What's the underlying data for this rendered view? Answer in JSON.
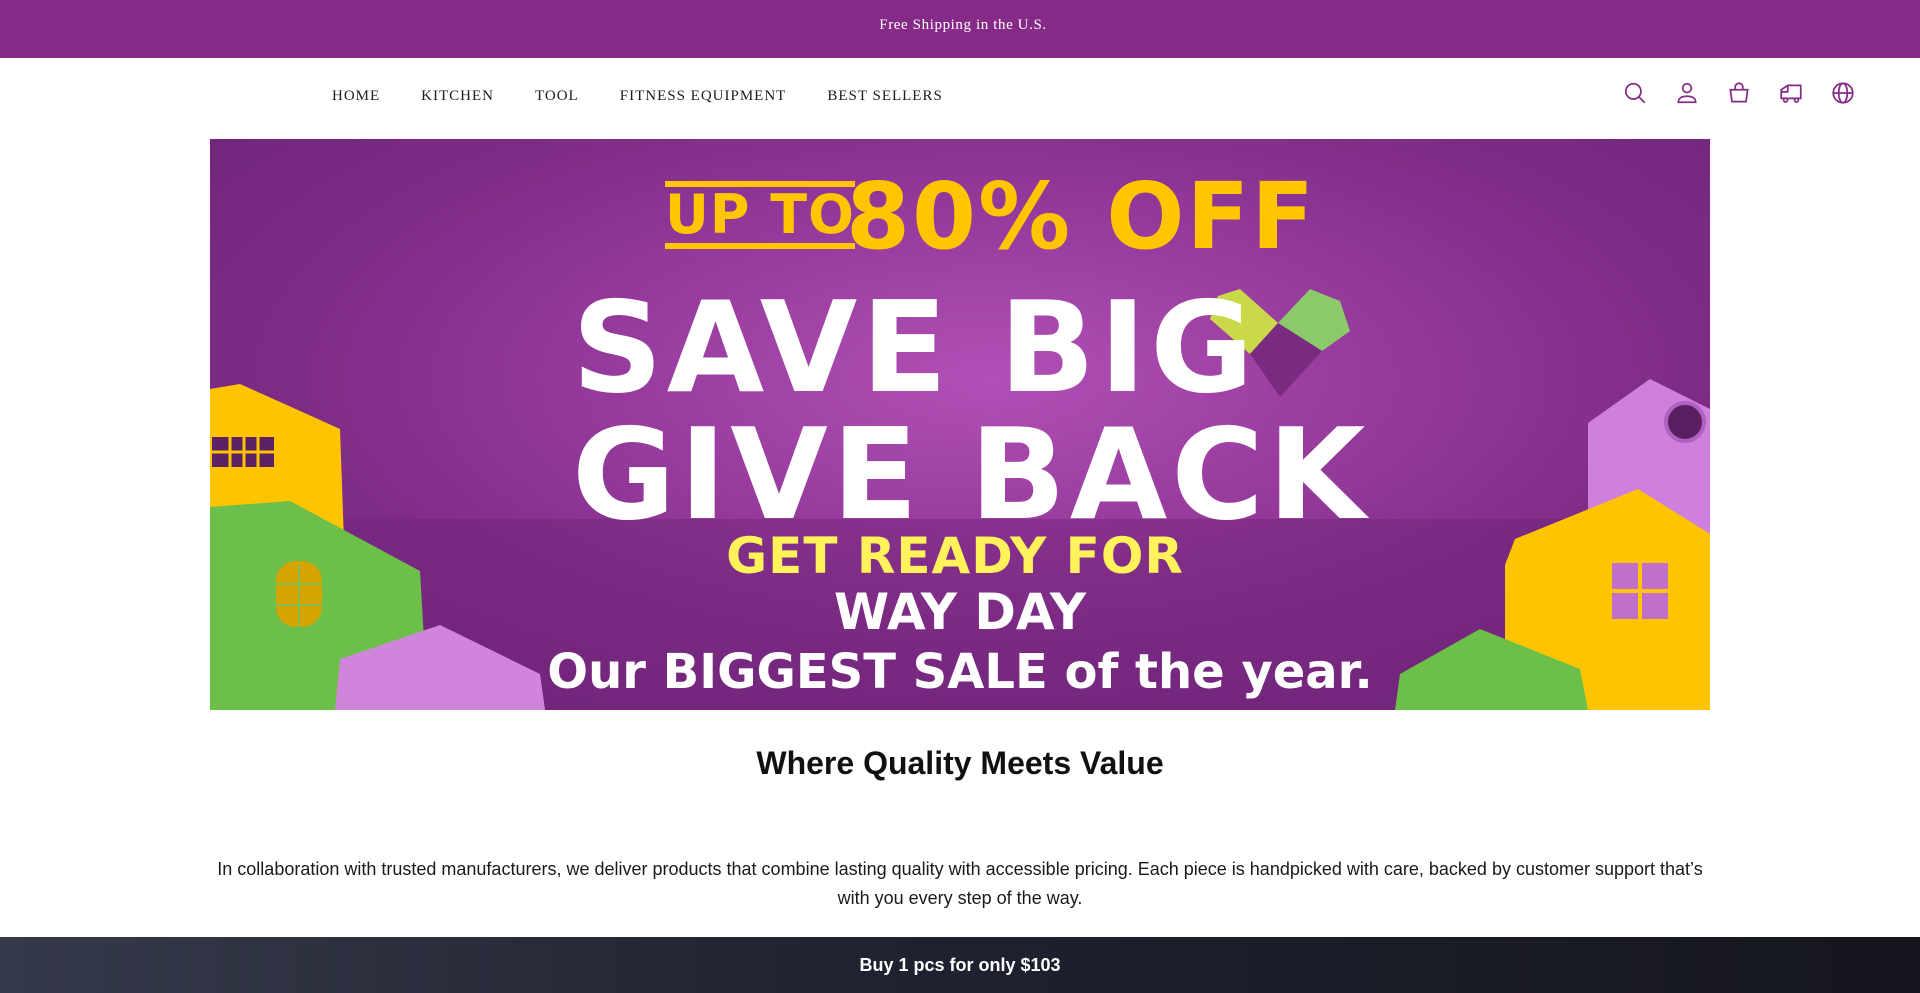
{
  "announcement": {
    "glyph": "",
    "text": "Free Shipping in the U.S."
  },
  "nav": {
    "items": [
      {
        "label": "HOME"
      },
      {
        "label": "KITCHEN"
      },
      {
        "label": "TOOL"
      },
      {
        "label": "FITNESS EQUIPMENT"
      },
      {
        "label": "BEST SELLERS"
      }
    ]
  },
  "header_icons": [
    "search-icon",
    "account-icon",
    "cart-icon",
    "tracking-icon",
    "language-icon"
  ],
  "banner": {
    "up_to": "UP TO",
    "discount": "80% OFF",
    "line1": "SAVE BIG",
    "line2": "GIVE BACK",
    "line3": "GET READY FOR",
    "line4": "WAY DAY",
    "line5": "Our BIGGEST SALE of the year."
  },
  "section": {
    "heading": "Where Quality Meets Value",
    "description": "In collaboration with trusted manufacturers, we deliver products that combine lasting quality with accessible pricing. Each piece is handpicked with care, backed by customer support that’s with you every step of the way."
  },
  "sticky_bar": {
    "text": "Buy 1 pcs for only $103"
  },
  "colors": {
    "brand": "#862a88",
    "banner_yellow": "#ffc500",
    "sticky_dark": "#1f2230"
  }
}
